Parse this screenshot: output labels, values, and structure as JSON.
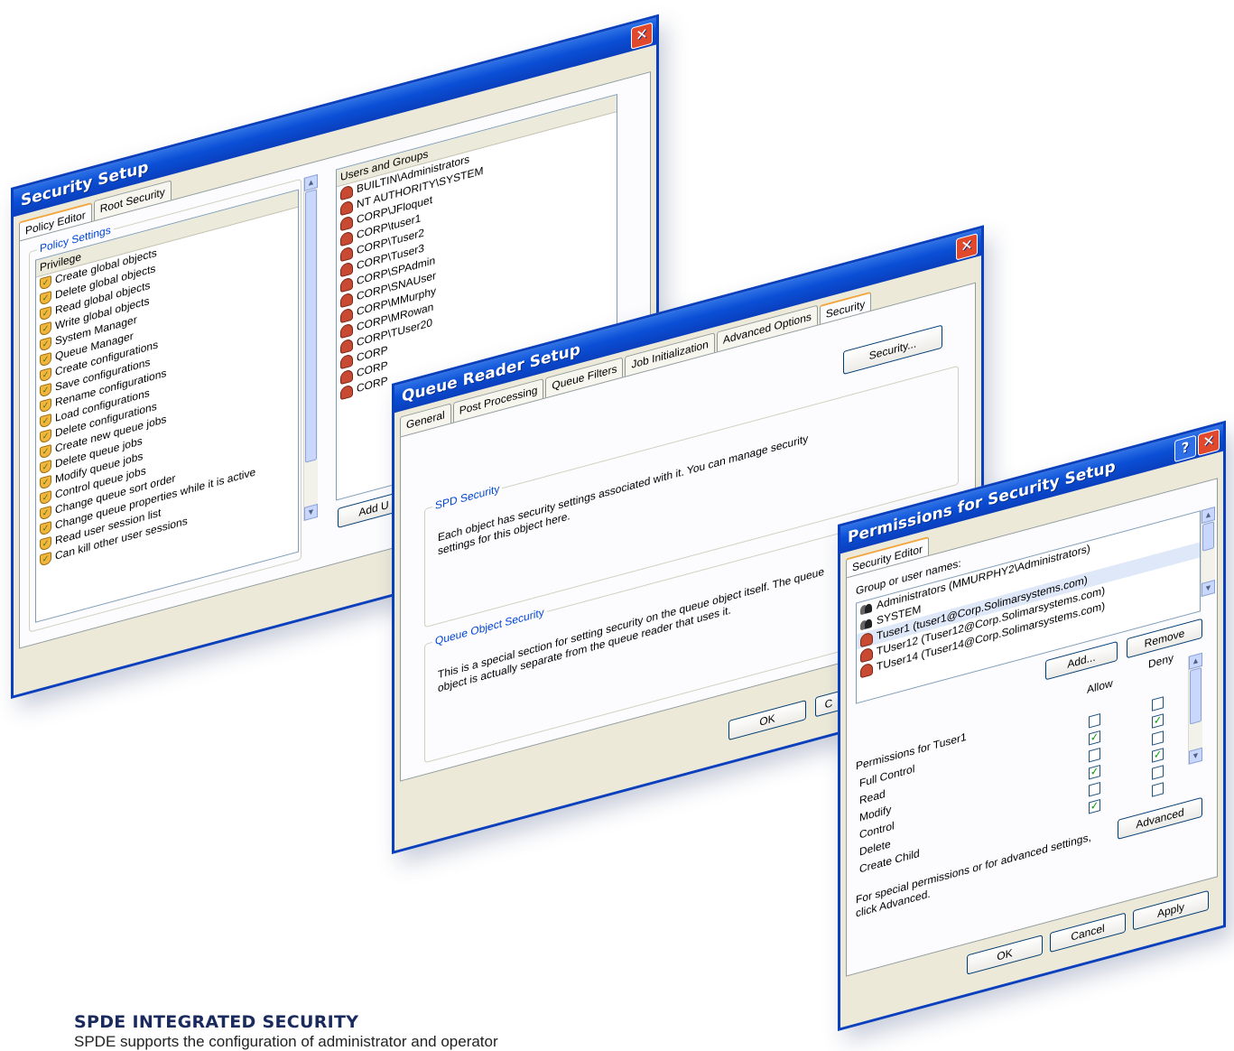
{
  "security_setup": {
    "title": "Security Setup",
    "tabs": [
      "Policy Editor",
      "Root Security"
    ],
    "group_label": "Policy Settings",
    "privilege_header": "Privilege",
    "privileges": [
      "Create global objects",
      "Delete global objects",
      "Read global objects",
      "Write global objects",
      "System Manager",
      "Queue Manager",
      "Create configurations",
      "Save configurations",
      "Rename configurations",
      "Load configurations",
      "Delete configurations",
      "Create new queue jobs",
      "Delete queue jobs",
      "Modify queue jobs",
      "Control queue jobs",
      "Change queue sort order",
      "Change queue properties while it is active",
      "Read user session list",
      "Can kill other user sessions"
    ],
    "users_header": "Users and Groups",
    "users": [
      "BUILTIN\\Administrators",
      "NT AUTHORITY\\SYSTEM",
      "CORP\\JFloquet",
      "CORP\\tuser1",
      "CORP\\Tuser2",
      "CORP\\Tuser3",
      "CORP\\SPAdmin",
      "CORP\\SNAUser",
      "CORP\\MMurphy",
      "CORP\\MRowan",
      "CORP\\TUser20",
      "CORP",
      "CORP",
      "CORP"
    ],
    "add_button": "Add U",
    "close": "✕"
  },
  "queue_reader": {
    "title": "Queue Reader Setup",
    "tabs": [
      "General",
      "Post Processing",
      "Queue Filters",
      "Job Initialization",
      "Advanced Options",
      "Security"
    ],
    "security_button": "Security...",
    "spd_label": "SPD Security",
    "spd_text": "Each object has security settings associated with it.  You can manage security settings for this object here.",
    "queue_label": "Queue Object Security",
    "queue_text": "This is a special section for setting security on the queue object itself. The queue object is actually separate from the queue reader that uses it.",
    "ok_button": "OK",
    "cancel_button": "C",
    "close": "✕"
  },
  "permissions": {
    "title": "Permissions for Security Setup",
    "tab": "Security Editor",
    "group_label": "Group or user names:",
    "names": [
      "Administrators (MMURPHY2\\Administrators)",
      "SYSTEM",
      "Tuser1 (tuser1@Corp.Solimarsystems.com)",
      "TUser12 (Tuser12@Corp.Solimarsystems.com)",
      "TUser14 (Tuser14@Corp.Solimarsystems.com)"
    ],
    "add_button": "Add...",
    "remove_button": "Remove",
    "permissions_for": "Permissions for Tuser1",
    "allow_header": "Allow",
    "deny_header": "Deny",
    "perms": [
      {
        "name": "Full Control",
        "allow": false,
        "deny": false
      },
      {
        "name": "Read",
        "allow": true,
        "deny": true
      },
      {
        "name": "Modify",
        "allow": false,
        "deny": false
      },
      {
        "name": "Control",
        "allow": true,
        "deny": true
      },
      {
        "name": "Delete",
        "allow": false,
        "deny": false
      },
      {
        "name": "Create Child",
        "allow": true,
        "deny": false
      }
    ],
    "advanced_button": "Advanced",
    "advanced_note": "For special permissions or for advanced settings, click Advanced.",
    "ok_button": "OK",
    "cancel_button": "Cancel",
    "apply_button": "Apply",
    "help": "?",
    "close": "✕"
  },
  "caption": {
    "title": "SPDE INTEGRATED SECURITY",
    "text": "SPDE supports the configuration of administrator and operator"
  }
}
